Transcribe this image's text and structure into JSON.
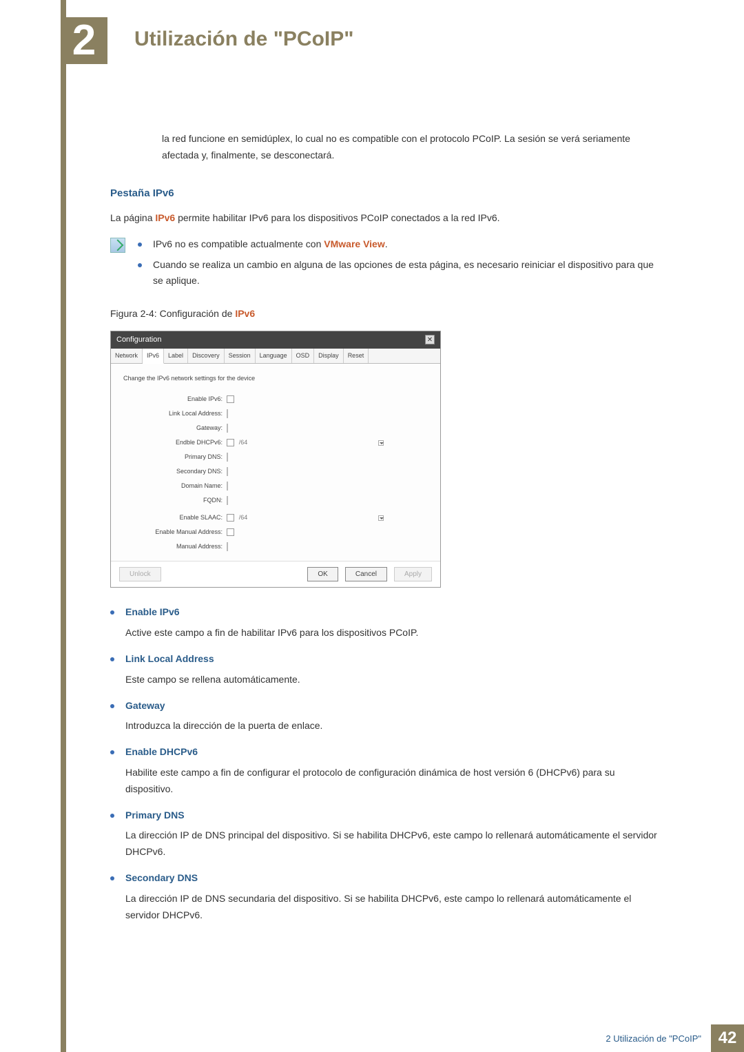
{
  "chapter": {
    "number": "2",
    "title": "Utilización de \"PCoIP\""
  },
  "intro_paragraph": "la red funcione en semidúplex, lo cual no es compatible con el protocolo PCoIP. La sesión se verá seriamente afectada y, finalmente, se desconectará.",
  "section": {
    "title": "Pestaña IPv6",
    "desc_pre": "La página ",
    "desc_hl": "IPv6",
    "desc_post": " permite habilitar IPv6 para los dispositivos PCoIP conectados a la red IPv6."
  },
  "notes": [
    {
      "pre": "IPv6 no es compatible actualmente con ",
      "hl": "VMware View",
      "post": "."
    },
    {
      "pre": "Cuando se realiza un cambio en alguna de las opciones de esta página, es necesario reiniciar el dispositivo para que se aplique.",
      "hl": "",
      "post": ""
    }
  ],
  "figure": {
    "pre": "Figura 2-4: Configuración de ",
    "hl": "IPv6"
  },
  "config_window": {
    "title": "Configuration",
    "tabs": [
      "Network",
      "IPv6",
      "Label",
      "Discovery",
      "Session",
      "Language",
      "OSD",
      "Display",
      "Reset"
    ],
    "active_tab": "IPv6",
    "description": "Change the IPv6 network settings for the device",
    "rows": [
      {
        "label": "Enable IPv6:",
        "type": "checkbox"
      },
      {
        "label": "Link Local Address:",
        "type": "input"
      },
      {
        "label": "Gateway:",
        "type": "input"
      },
      {
        "label": "Endble DHCPv6:",
        "type": "checkbox_suffix",
        "suffix": "/64",
        "dropdown": true
      },
      {
        "label": "Primary DNS:",
        "type": "input"
      },
      {
        "label": "Secondary DNS:",
        "type": "input"
      },
      {
        "label": "Domain Name:",
        "type": "input_long"
      },
      {
        "label": "FQDN:",
        "type": "input_long"
      },
      {
        "label": "Enable SLAAC:",
        "type": "checkbox_suffix",
        "suffix": "/64",
        "dropdown": true
      },
      {
        "label": "Enable Manual Address:",
        "type": "checkbox"
      },
      {
        "label": "Manual Address:",
        "type": "input"
      }
    ],
    "buttons": {
      "unlock": "Unlock",
      "ok": "OK",
      "cancel": "Cancel",
      "apply": "Apply"
    }
  },
  "definitions": [
    {
      "title": "Enable IPv6",
      "body": "Active este campo a fin de habilitar IPv6 para los dispositivos PCoIP."
    },
    {
      "title": "Link Local Address",
      "body": "Este campo se rellena automáticamente."
    },
    {
      "title": "Gateway",
      "body": "Introduzca la dirección de la puerta de enlace."
    },
    {
      "title": "Enable DHCPv6",
      "body": "Habilite este campo a fin de configurar el protocolo de configuración dinámica de host versión 6 (DHCPv6) para su dispositivo."
    },
    {
      "title": "Primary DNS",
      "body": "La dirección IP de DNS principal del dispositivo. Si se habilita DHCPv6, este campo lo rellenará automáticamente el servidor DHCPv6."
    },
    {
      "title": "Secondary DNS",
      "body": "La dirección IP de DNS secundaria del dispositivo. Si se habilita DHCPv6, este campo lo rellenará automáticamente el servidor DHCPv6."
    }
  ],
  "footer": {
    "text": "2 Utilización de \"PCoIP\"",
    "page": "42"
  }
}
